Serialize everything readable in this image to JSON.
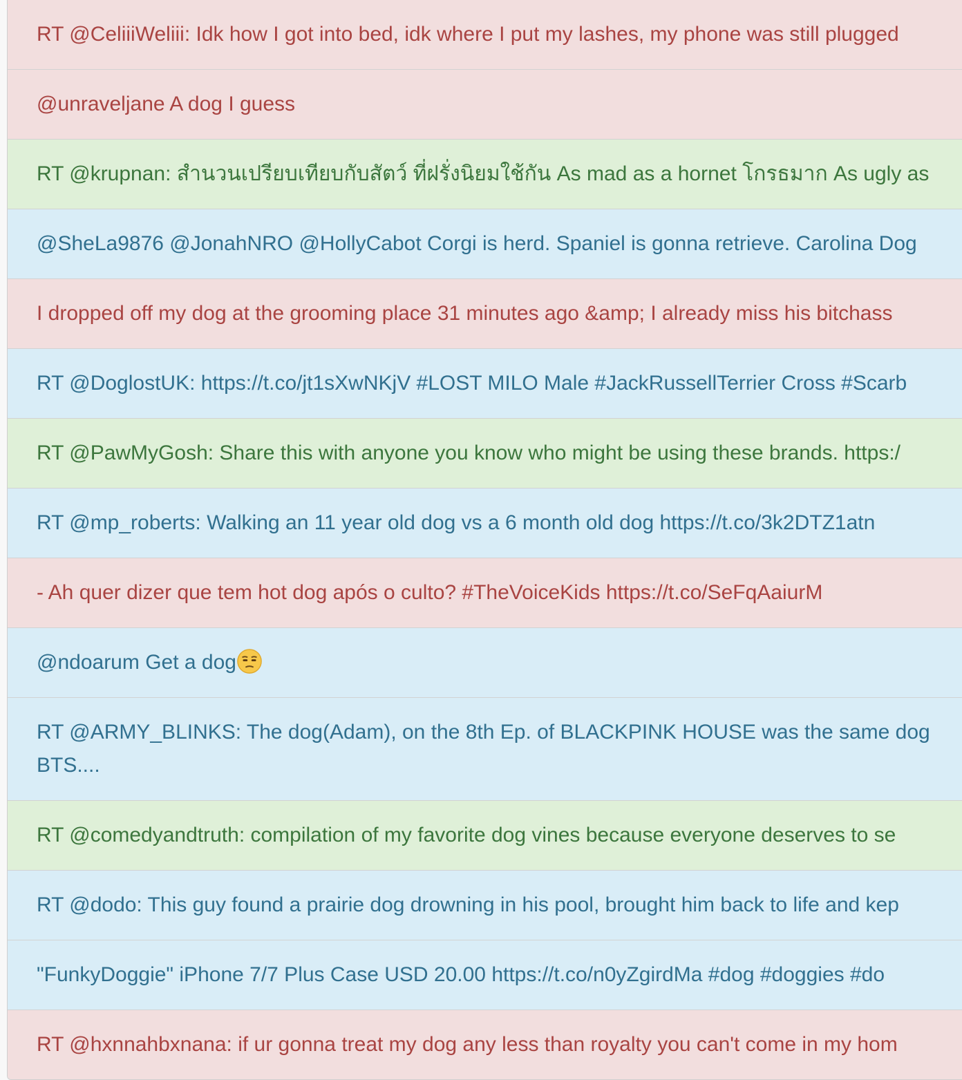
{
  "colors": {
    "negative_bg": "#f2dede",
    "negative_text": "#a94442",
    "positive_bg": "#dff0d8",
    "positive_text": "#3c763d",
    "neutral_bg": "#d9edf7",
    "neutral_text": "#31708f"
  },
  "tweets": [
    {
      "sentiment": "negative",
      "text": "RT @CeliiiWeliii: Idk how I got into bed, idk where I put my lashes, my phone was still plugged"
    },
    {
      "sentiment": "negative",
      "text": "@unraveljane A dog I guess"
    },
    {
      "sentiment": "positive",
      "text": "RT @krupnan: สำนวนเปรียบเทียบกับสัตว์ ที่ฝรั่งนิยมใช้กัน As mad as a hornet โกรธมาก As ugly as"
    },
    {
      "sentiment": "neutral",
      "text": "@SheLa9876 @JonahNRO @HollyCabot Corgi is herd. Spaniel is gonna retrieve. Carolina Dog"
    },
    {
      "sentiment": "negative",
      "text": "I dropped off my dog at the grooming place 31 minutes ago &amp; I already miss his bitchass"
    },
    {
      "sentiment": "neutral",
      "text": "RT @DoglostUK: https://t.co/jt1sXwNKjV #LOST MILO Male #JackRussellTerrier Cross #Scarb"
    },
    {
      "sentiment": "positive",
      "text": "RT @PawMyGosh: Share this with anyone you know who might be using these brands. https:/"
    },
    {
      "sentiment": "neutral",
      "text": "RT @mp_roberts: Walking an 11 year old dog vs a 6 month old dog https://t.co/3k2DTZ1atn"
    },
    {
      "sentiment": "negative",
      "text": "- Ah quer dizer que tem hot dog após o culto? #TheVoiceKids https://t.co/SeFqAaiurM"
    },
    {
      "sentiment": "neutral",
      "text": "@ndoarum Get a dog",
      "emoji": "unamused-face-icon"
    },
    {
      "sentiment": "neutral",
      "text": "RT @ARMY_BLINKS: The dog(Adam), on the 8th Ep. of BLACKPINK HOUSE was the same dog",
      "text_line2": "BTS...."
    },
    {
      "sentiment": "positive",
      "text": "RT @comedyandtruth: compilation of my favorite dog vines because everyone deserves to se"
    },
    {
      "sentiment": "neutral",
      "text": "RT @dodo: This guy found a prairie dog drowning in his pool, brought him back to life and kep"
    },
    {
      "sentiment": "neutral",
      "text": "\"FunkyDoggie\" iPhone 7/7 Plus Case USD 20.00 https://t.co/n0yZgirdMa #dog #doggies #do"
    },
    {
      "sentiment": "negative",
      "text": "RT @hxnnahbxnana: if ur gonna treat my dog any less than royalty you can't come in my hom"
    }
  ]
}
